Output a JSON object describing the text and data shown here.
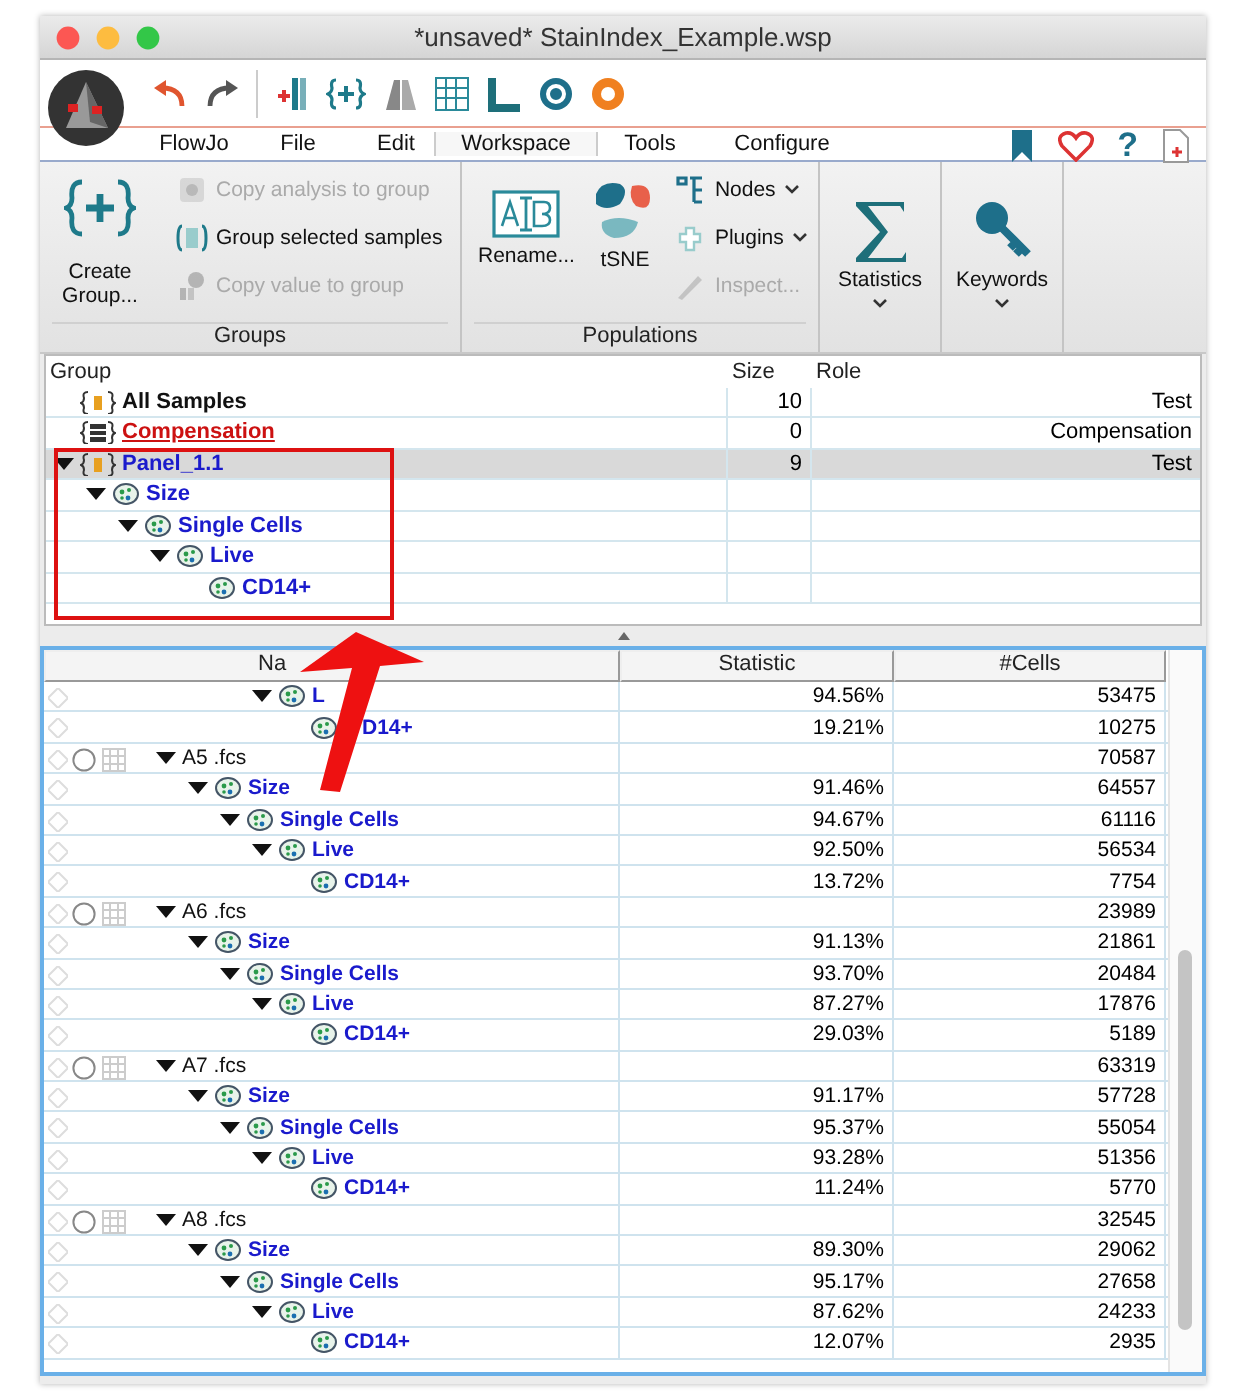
{
  "window": {
    "title": "*unsaved* StainIndex_Example.wsp"
  },
  "menu": [
    {
      "label": "FlowJo",
      "selected": false
    },
    {
      "label": "File",
      "selected": false
    },
    {
      "label": "Edit",
      "selected": false
    },
    {
      "label": "Workspace",
      "selected": true
    },
    {
      "label": "Tools",
      "selected": false
    },
    {
      "label": "Configure",
      "selected": false
    }
  ],
  "help_glyph": "?",
  "ribbon": {
    "groups": {
      "label": "Groups",
      "create": "Create Group...",
      "items": [
        {
          "label": "Copy analysis to group",
          "disabled": true
        },
        {
          "label": "Group selected samples",
          "disabled": false
        },
        {
          "label": "Copy value to group",
          "disabled": true
        }
      ]
    },
    "populations": {
      "label": "Populations",
      "rename": "Rename...",
      "tsne": "tSNE",
      "items": [
        {
          "label": "Nodes",
          "disabled": false,
          "dropdown": true
        },
        {
          "label": "Plugins",
          "disabled": false,
          "dropdown": true
        },
        {
          "label": "Inspect...",
          "disabled": true,
          "dropdown": false
        }
      ]
    },
    "statistics": {
      "label": "Statistics"
    },
    "keywords": {
      "label": "Keywords"
    }
  },
  "group_table": {
    "columns": [
      "Group",
      "Size",
      "Role"
    ],
    "rows": [
      {
        "kind": "all",
        "name": "All Samples",
        "size": "10",
        "role": "Test",
        "selected": false
      },
      {
        "kind": "compensation",
        "name": "Compensation",
        "size": "0",
        "role": "Compensation",
        "selected": false
      },
      {
        "kind": "group",
        "name": "Panel_1.1",
        "size": "9",
        "role": "Test",
        "selected": true,
        "expanded": true,
        "children": [
          {
            "kind": "gate",
            "name": "Size",
            "selected": false,
            "expanded": true,
            "children": [
              {
                "kind": "gate",
                "name": "Single Cells",
                "selected": false,
                "expanded": true,
                "children": [
                  {
                    "kind": "gate",
                    "name": "Live",
                    "selected": false,
                    "expanded": true,
                    "children": [
                      {
                        "kind": "gate",
                        "name": "CD14+",
                        "selected": false
                      }
                    ]
                  }
                ]
              }
            ]
          }
        ]
      }
    ]
  },
  "sample_table": {
    "columns": [
      "Na",
      "Statistic",
      "#Cells"
    ],
    "rows": [
      {
        "kind": "offscreen",
        "children": [
          {
            "kind": "offscreen",
            "children": [
              {
                "kind": "offscreen",
                "children": [
                  {
                    "kind": "gate",
                    "name": "L",
                    "statistic": "94.56%",
                    "cells": "53475",
                    "expanded": true,
                    "children": [
                      {
                        "kind": "gate",
                        "name": "D14+",
                        "statistic": "19.21%",
                        "cells": "10275"
                      }
                    ]
                  }
                ]
              }
            ]
          }
        ]
      },
      {
        "kind": "sample",
        "name": "A5 .fcs",
        "cells": "70587",
        "expanded": true,
        "children": [
          {
            "kind": "gate",
            "name": "Size",
            "statistic": "91.46%",
            "cells": "64557",
            "expanded": true,
            "children": [
              {
                "kind": "gate",
                "name": "Single Cells",
                "statistic": "94.67%",
                "cells": "61116",
                "expanded": true,
                "children": [
                  {
                    "kind": "gate",
                    "name": "Live",
                    "statistic": "92.50%",
                    "cells": "56534",
                    "expanded": true,
                    "children": [
                      {
                        "kind": "gate",
                        "name": "CD14+",
                        "statistic": "13.72%",
                        "cells": "7754"
                      }
                    ]
                  }
                ]
              }
            ]
          }
        ]
      },
      {
        "kind": "sample",
        "name": "A6 .fcs",
        "cells": "23989",
        "expanded": true,
        "children": [
          {
            "kind": "gate",
            "name": "Size",
            "statistic": "91.13%",
            "cells": "21861",
            "expanded": true,
            "children": [
              {
                "kind": "gate",
                "name": "Single Cells",
                "statistic": "93.70%",
                "cells": "20484",
                "expanded": true,
                "children": [
                  {
                    "kind": "gate",
                    "name": "Live",
                    "statistic": "87.27%",
                    "cells": "17876",
                    "expanded": true,
                    "children": [
                      {
                        "kind": "gate",
                        "name": "CD14+",
                        "statistic": "29.03%",
                        "cells": "5189"
                      }
                    ]
                  }
                ]
              }
            ]
          }
        ]
      },
      {
        "kind": "sample",
        "name": "A7 .fcs",
        "cells": "63319",
        "expanded": true,
        "children": [
          {
            "kind": "gate",
            "name": "Size",
            "statistic": "91.17%",
            "cells": "57728",
            "expanded": true,
            "children": [
              {
                "kind": "gate",
                "name": "Single Cells",
                "statistic": "95.37%",
                "cells": "55054",
                "expanded": true,
                "children": [
                  {
                    "kind": "gate",
                    "name": "Live",
                    "statistic": "93.28%",
                    "cells": "51356",
                    "expanded": true,
                    "children": [
                      {
                        "kind": "gate",
                        "name": "CD14+",
                        "statistic": "11.24%",
                        "cells": "5770"
                      }
                    ]
                  }
                ]
              }
            ]
          }
        ]
      },
      {
        "kind": "sample",
        "name": "A8 .fcs",
        "cells": "32545",
        "expanded": true,
        "children": [
          {
            "kind": "gate",
            "name": "Size",
            "statistic": "89.30%",
            "cells": "29062",
            "expanded": true,
            "children": [
              {
                "kind": "gate",
                "name": "Single Cells",
                "statistic": "95.17%",
                "cells": "27658",
                "expanded": true,
                "children": [
                  {
                    "kind": "gate",
                    "name": "Live",
                    "statistic": "87.62%",
                    "cells": "24233",
                    "expanded": true,
                    "children": [
                      {
                        "kind": "gate",
                        "name": "CD14+",
                        "statistic": "12.07%",
                        "cells": "2935"
                      }
                    ]
                  }
                ]
              }
            ]
          }
        ]
      }
    ]
  }
}
